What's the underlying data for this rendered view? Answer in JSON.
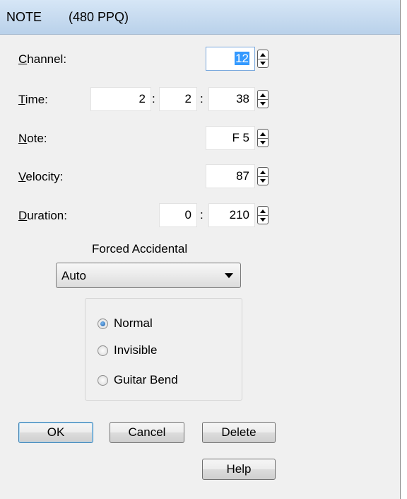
{
  "window": {
    "title": "NOTE",
    "ppq": "(480 PPQ)"
  },
  "fields": {
    "channel": {
      "label_first": "C",
      "label_rest": "hannel:",
      "value": "12"
    },
    "time": {
      "label_first": "T",
      "label_rest": "ime:",
      "bar": "2",
      "beat": "2",
      "tick": "38",
      "sep": ":"
    },
    "note": {
      "label_first": "N",
      "label_rest": "ote:",
      "value": "F 5"
    },
    "velocity": {
      "label_first": "V",
      "label_rest": "elocity:",
      "value": "87"
    },
    "duration": {
      "label_first": "D",
      "label_rest": "uration:",
      "beats": "0",
      "ticks": "210",
      "sep": ":"
    }
  },
  "forced_accidental": {
    "label": "Forced Accidental",
    "selected": "Auto"
  },
  "display_options": [
    {
      "label": "Normal",
      "checked": true
    },
    {
      "label": "Invisible",
      "checked": false
    },
    {
      "label": "Guitar Bend",
      "checked": false
    }
  ],
  "buttons": {
    "ok": "OK",
    "cancel": "Cancel",
    "delete": "Delete",
    "help": "Help"
  }
}
